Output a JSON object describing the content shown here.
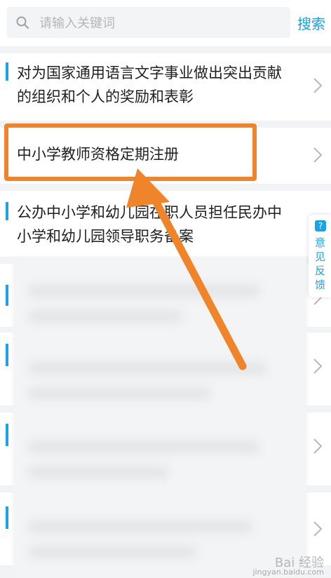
{
  "search": {
    "placeholder": "请输入关键词",
    "button_label": "搜索"
  },
  "list": {
    "items": [
      {
        "title": "对为国家通用语言文字事业做出突出贡献的组织和个人的奖励和表彰"
      },
      {
        "title": "中小学教师资格定期注册"
      },
      {
        "title": "公办中小学和幼儿园在职人员担任民办中小学和幼儿园领导职务备案"
      }
    ]
  },
  "feedback": {
    "label": "意见反馈",
    "icon": "?"
  },
  "watermark": {
    "brand": "Bai 经验",
    "url": "jingyan.baidu.com"
  },
  "colors": {
    "accent": "#1aa3e6",
    "highlight": "#f0842a",
    "search_link": "#1a9ee8"
  }
}
